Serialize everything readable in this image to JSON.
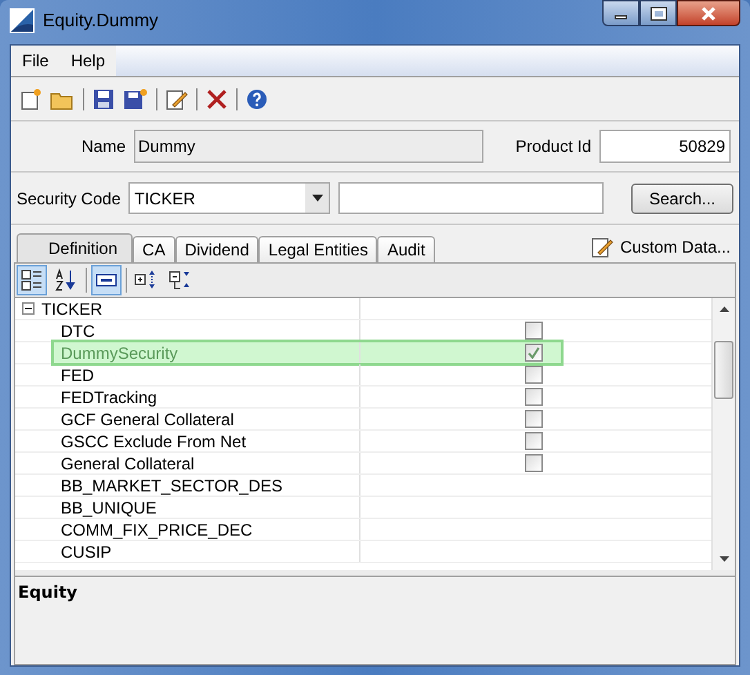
{
  "window": {
    "title": "Equity.Dummy"
  },
  "menu": [
    "File",
    "Help"
  ],
  "form": {
    "name_label": "Name",
    "name_value": "Dummy",
    "product_id_label": "Product Id",
    "product_id_value": "50829",
    "security_code_label": "Security Code",
    "security_code_value": "TICKER",
    "search_button": "Search..."
  },
  "tabs": [
    {
      "label": "Definition",
      "selected": true
    },
    {
      "label": "CA",
      "selected": false
    },
    {
      "label": "Dividend",
      "selected": false
    },
    {
      "label": "Legal Entities",
      "selected": false
    },
    {
      "label": "Audit",
      "selected": false
    }
  ],
  "custom_data_button": "Custom Data...",
  "grid_toolbar": [
    {
      "kind": "categorized",
      "selected": true
    },
    {
      "kind": "alphabetical",
      "selected": false
    },
    {
      "kind": "pages",
      "selected": true
    },
    {
      "kind": "expand",
      "selected": false
    },
    {
      "kind": "collapse",
      "selected": false
    }
  ],
  "property_grid": {
    "category": "TICKER",
    "expanded": true,
    "rows": [
      {
        "name": "DTC",
        "kind": "checkbox",
        "checked": false,
        "selected": false
      },
      {
        "name": "DummySecurity",
        "kind": "checkbox",
        "checked": true,
        "selected": true
      },
      {
        "name": "FED",
        "kind": "checkbox",
        "checked": false,
        "selected": false
      },
      {
        "name": "FEDTracking",
        "kind": "checkbox",
        "checked": false,
        "selected": false
      },
      {
        "name": "GCF General Collateral",
        "kind": "checkbox",
        "checked": false,
        "selected": false
      },
      {
        "name": "GSCC Exclude From Net",
        "kind": "checkbox",
        "checked": false,
        "selected": false
      },
      {
        "name": "General Collateral",
        "kind": "checkbox",
        "checked": false,
        "selected": false
      },
      {
        "name": "BB_MARKET_SECTOR_DES",
        "kind": "text",
        "selected": false
      },
      {
        "name": "BB_UNIQUE",
        "kind": "text",
        "selected": false
      },
      {
        "name": "COMM_FIX_PRICE_DEC",
        "kind": "text",
        "selected": false
      },
      {
        "name": "CUSIP",
        "kind": "text",
        "selected": false
      }
    ]
  },
  "description": {
    "title": "Equity"
  }
}
